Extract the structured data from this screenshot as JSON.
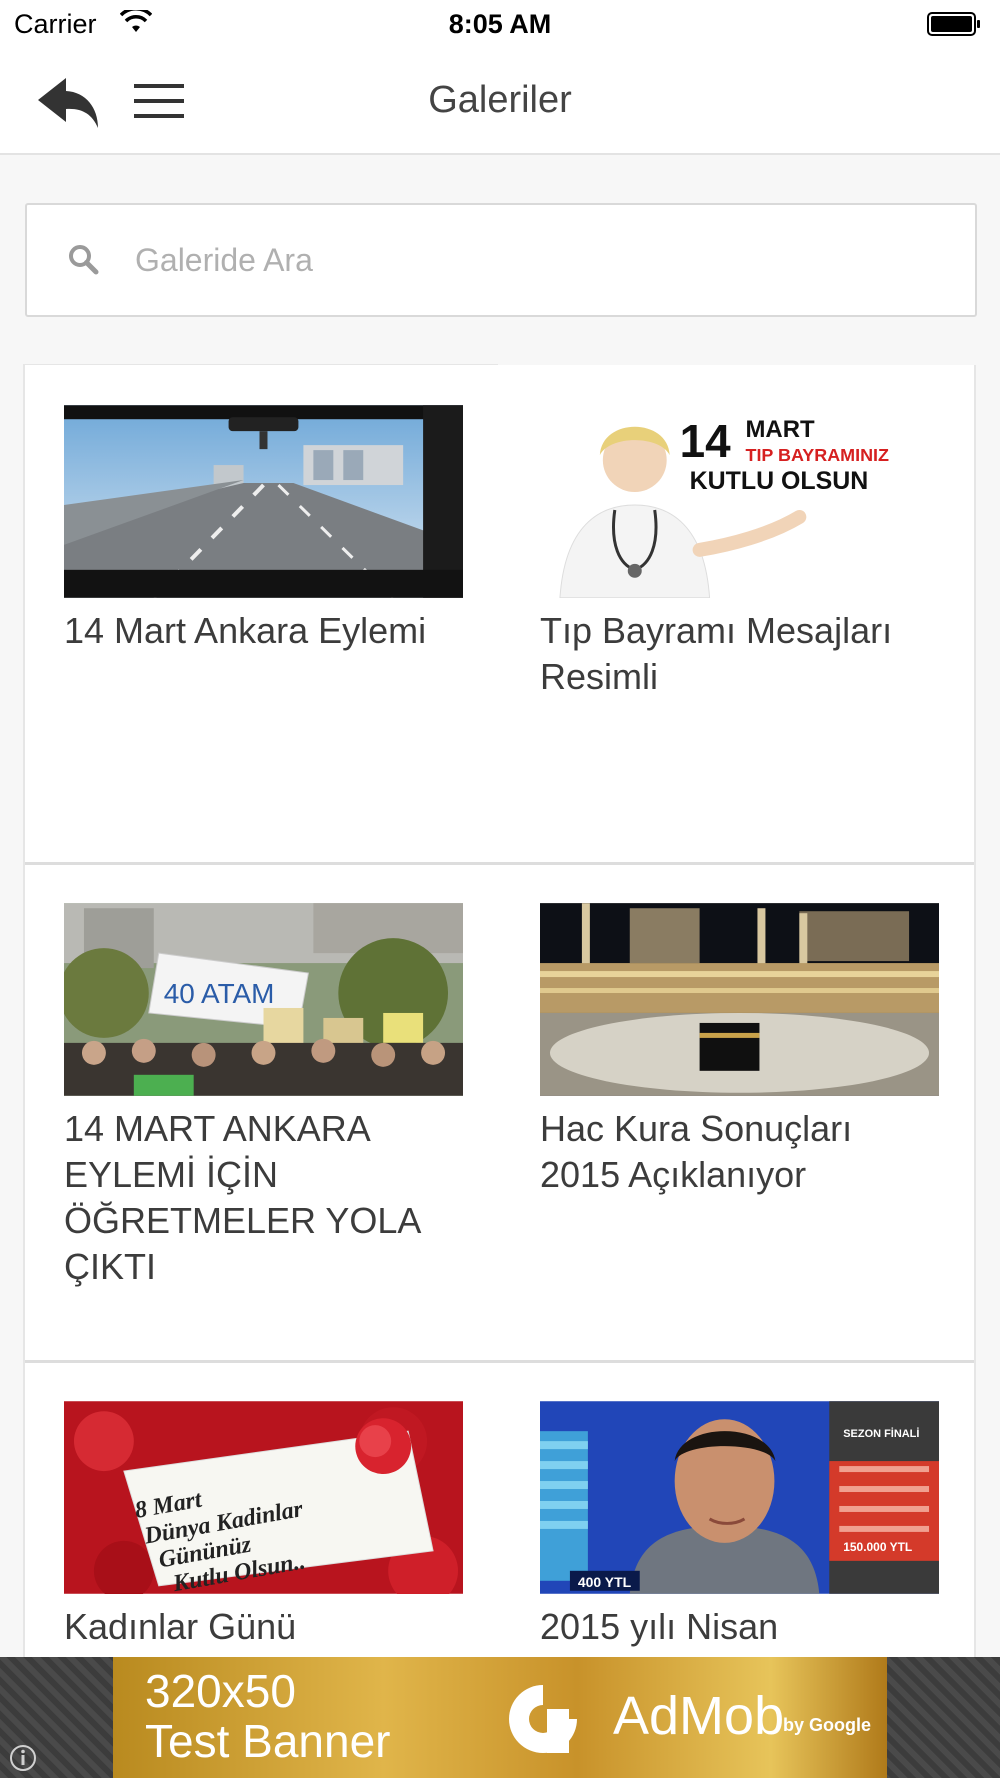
{
  "status_bar": {
    "carrier": "Carrier",
    "time": "8:05 AM"
  },
  "nav": {
    "title": "Galeriler"
  },
  "search": {
    "placeholder": "Galeride Ara",
    "value": ""
  },
  "gallery": {
    "items": [
      {
        "title": "14 Mart Ankara Eylemi"
      },
      {
        "title": "Tıp Bayramı Mesajları Resimli",
        "image_text": [
          "14",
          "MART",
          "TIP BAYRAMINIZ",
          "KUTLU OLSUN"
        ]
      },
      {
        "title": "14 MART ANKARA EYLEMİ İÇİN ÖĞRETMELER YOLA ÇIKTI",
        "image_text": [
          "40 ATAM"
        ]
      },
      {
        "title": "Hac Kura Sonuçları 2015 Açıklanıyor"
      },
      {
        "title": "Kadınlar Günü",
        "image_text": [
          "8 Mart",
          "Dünya Kadinlar",
          "Gününüz",
          "Kutlu Olsun.."
        ]
      },
      {
        "title": "2015 yılı Nisan",
        "image_text": [
          "400 YTL",
          "150.000 YTL",
          "SEZON FİNALİ"
        ]
      }
    ]
  },
  "ad": {
    "size": "320x50",
    "label": "Test Banner",
    "brand": "AdMob",
    "by": "by Google"
  },
  "colors": {
    "background": "#f7f7f7",
    "card": "#ffffff",
    "divider": "#dddddd",
    "ad_gold": "#c8922a"
  }
}
